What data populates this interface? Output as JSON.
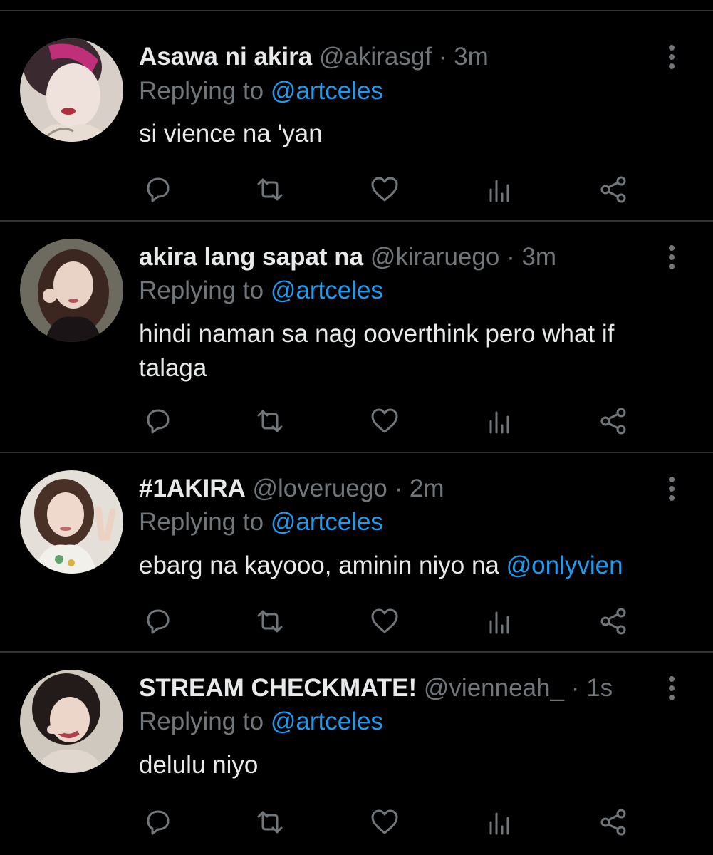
{
  "colors": {
    "background": "#000000",
    "divider": "#2f3336",
    "primary_text": "#e7e9ea",
    "secondary_text": "#71767b",
    "link": "#1d9bf0"
  },
  "tweets": [
    {
      "name": "Asawa ni akira",
      "handle": "@akirasgf",
      "separator": "·",
      "time": "3m",
      "replying_prefix": "Replying to ",
      "replying_to": "@artceles",
      "text": "si vience na 'yan",
      "mention": "",
      "avatar_icon": "user-photo"
    },
    {
      "name": "akira lang sapat na",
      "handle": "@kiraruego",
      "separator": "·",
      "time": "3m",
      "replying_prefix": "Replying to ",
      "replying_to": "@artceles",
      "text": "hindi naman sa nag ooverthink pero what if talaga",
      "mention": "",
      "avatar_icon": "user-photo"
    },
    {
      "name": "#1AKIRA",
      "handle": "@loveruego",
      "separator": "·",
      "time": "2m",
      "replying_prefix": "Replying to ",
      "replying_to": "@artceles",
      "text": "ebarg na kayooo, aminin niyo na ",
      "mention": "@onlyvien",
      "avatar_icon": "user-photo"
    },
    {
      "name": "STREAM CHECKMATE!",
      "handle": "@vienneah_",
      "separator": "·",
      "time": "1s",
      "replying_prefix": "Replying to ",
      "replying_to": "@artceles",
      "text": "delulu niyo",
      "mention": "",
      "avatar_icon": "user-photo"
    }
  ],
  "action_icons": [
    "reply-icon",
    "retweet-icon",
    "like-icon",
    "analytics-icon",
    "share-icon"
  ],
  "more_icon": "more-vertical-icon"
}
